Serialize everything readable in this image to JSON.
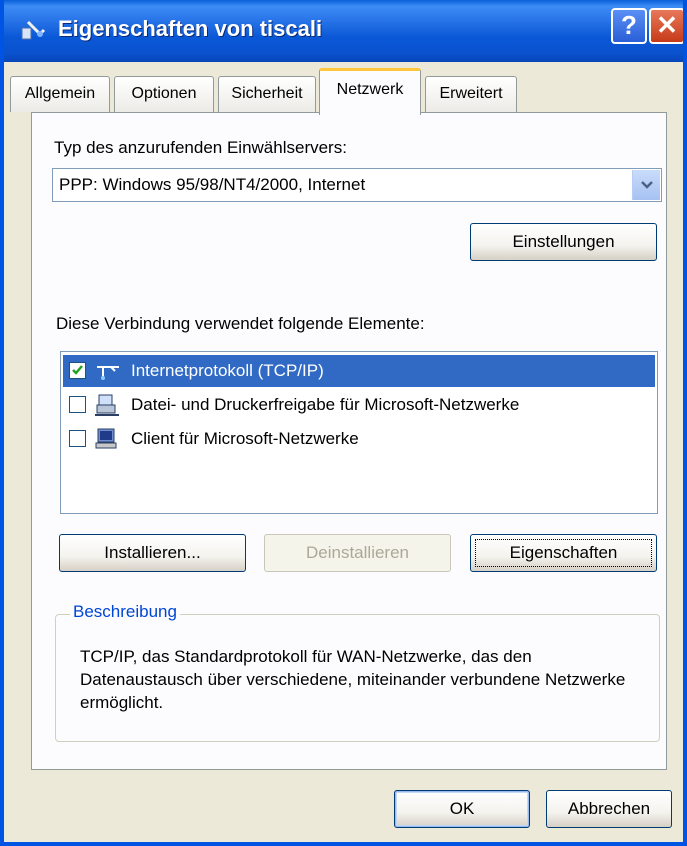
{
  "window": {
    "title": "Eigenschaften von tiscali",
    "help_label": "?",
    "close_label": "✕",
    "title_icon": "network-connection-icon"
  },
  "tabs": [
    {
      "label": "Allgemein"
    },
    {
      "label": "Optionen"
    },
    {
      "label": "Sicherheit"
    },
    {
      "label": "Netzwerk",
      "active": true
    },
    {
      "label": "Erweitert"
    }
  ],
  "server_type": {
    "label": "Typ des anzurufenden Einwählservers:",
    "selected": "PPP: Windows 95/98/NT4/2000, Internet",
    "settings_button": "Einstellungen"
  },
  "components": {
    "label": "Diese Verbindung verwendet folgende Elemente:",
    "items": [
      {
        "label": "Internetprotokoll (TCP/IP)",
        "checked": true,
        "selected": true,
        "icon": "network-protocol-icon"
      },
      {
        "label": "Datei- und Druckerfreigabe für Microsoft-Netzwerke",
        "checked": false,
        "selected": false,
        "icon": "network-service-icon"
      },
      {
        "label": "Client für Microsoft-Netzwerke",
        "checked": false,
        "selected": false,
        "icon": "network-client-icon"
      }
    ]
  },
  "buttons": {
    "install": "Installieren...",
    "uninstall": "Deinstallieren",
    "properties": "Eigenschaften"
  },
  "description": {
    "legend": "Beschreibung",
    "text": "TCP/IP, das Standardprotokoll für WAN-Netzwerke, das den Datenaustausch über verschiedene, miteinander verbundene Netzwerke ermöglicht."
  },
  "footer": {
    "ok": "OK",
    "cancel": "Abbrechen"
  },
  "colors": {
    "title_bar": "#0a58d6",
    "selection": "#316ac5",
    "dialog_bg": "#ece9d8",
    "active_tab_accent": "#ffc83c"
  }
}
